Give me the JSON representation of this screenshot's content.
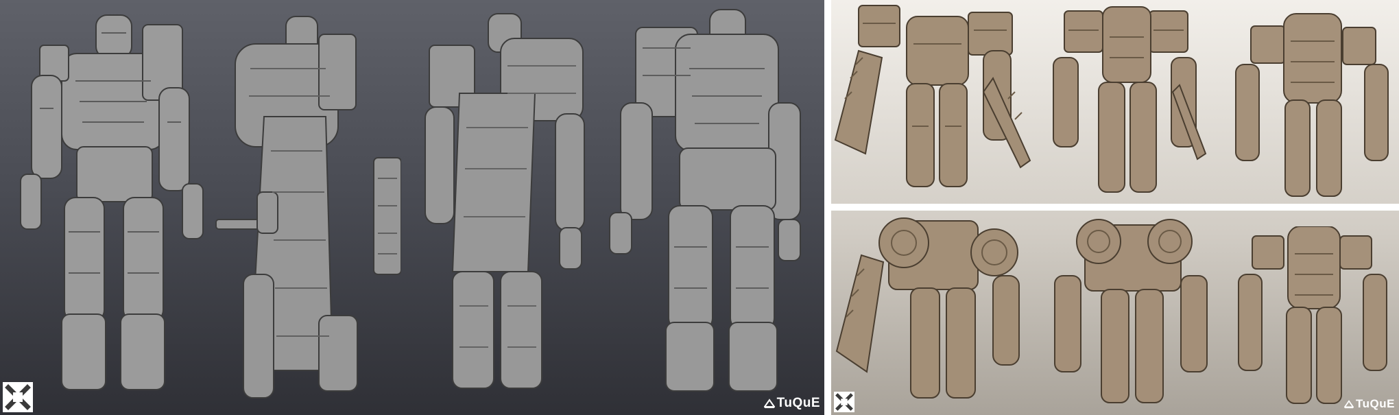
{
  "left_sheet": {
    "background": "#4a4c54",
    "model_color": "#9a9a9a",
    "studio_mark": "TuQuE",
    "corner_logo_icon": "crossed-tools-logo-icon"
  },
  "right_sheet": {
    "background": "#d2cdc5",
    "model_color": "#a08c74",
    "studio_mark": "TuQuE",
    "corner_logo_icon": "crossed-tools-logo-icon"
  }
}
